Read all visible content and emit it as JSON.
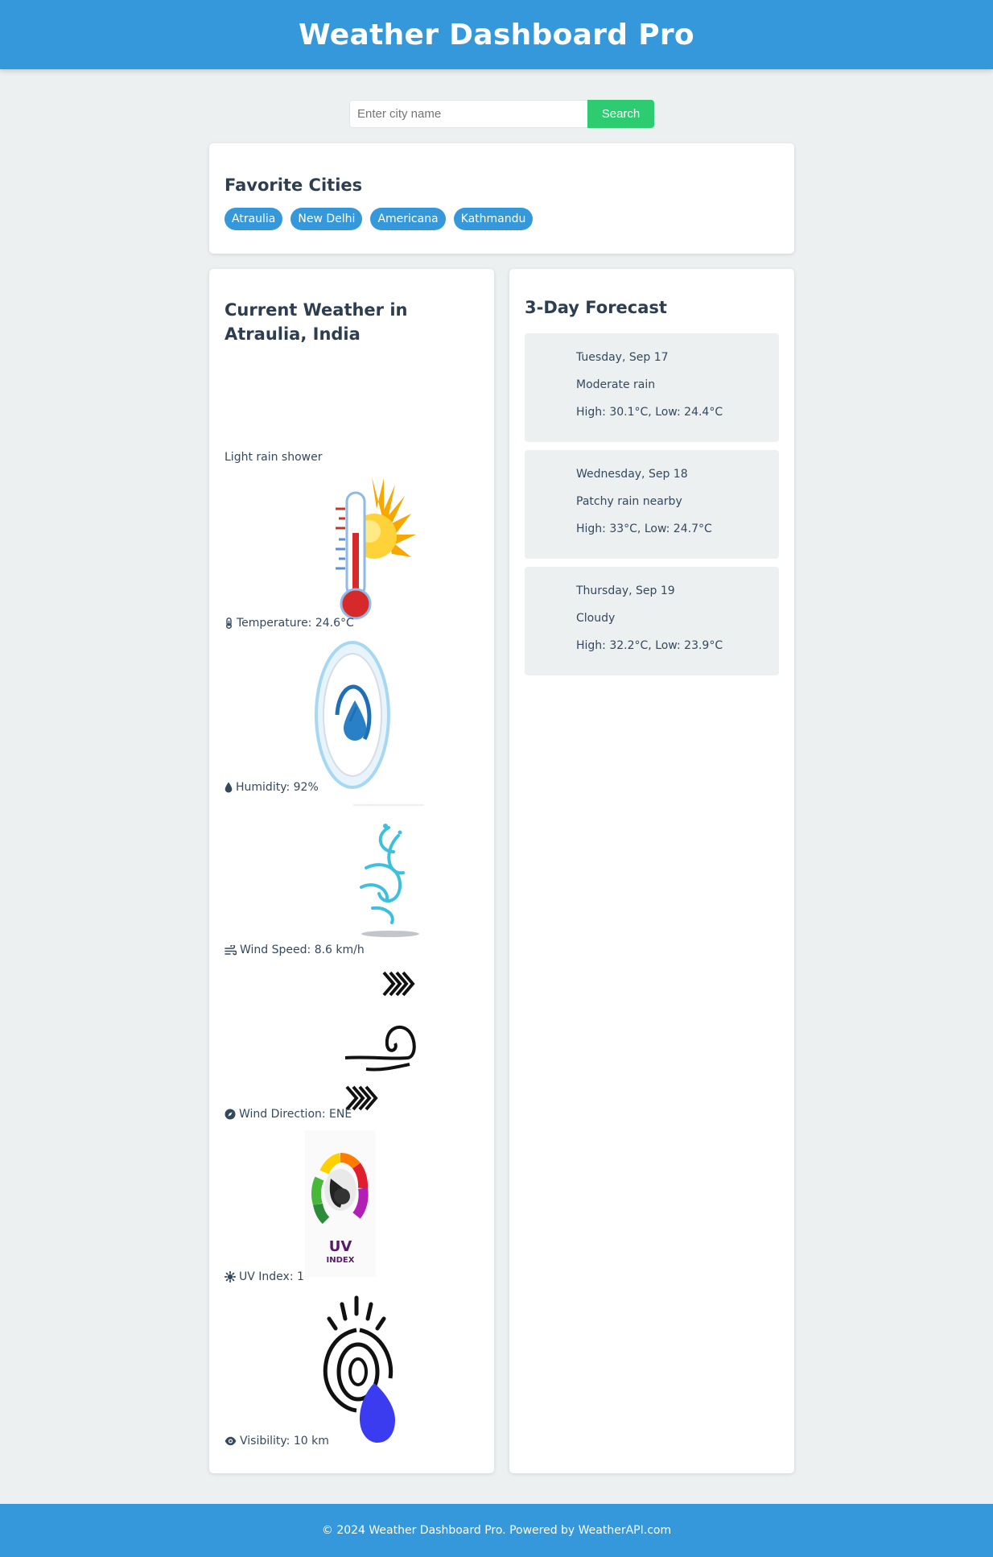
{
  "header": {
    "title": "Weather Dashboard Pro"
  },
  "search": {
    "placeholder": "Enter city name",
    "value": "",
    "button_label": "Search"
  },
  "favorites": {
    "title": "Favorite Cities",
    "cities": [
      "Atraulia",
      "New Delhi",
      "Americana",
      "Kathmandu"
    ]
  },
  "current": {
    "title": "Current Weather in Atraulia, India",
    "condition": "Light rain shower",
    "metrics": [
      {
        "icon": "thermometer-icon",
        "text": "Temperature: 24.6°C"
      },
      {
        "icon": "tint-icon",
        "text": "Humidity: 92%"
      },
      {
        "icon": "wind-icon",
        "text": "Wind Speed: 8.6 km/h"
      },
      {
        "icon": "compass-icon",
        "text": "Wind Direction: ENE"
      },
      {
        "icon": "sun-icon",
        "text": "UV Index: 1"
      },
      {
        "icon": "eye-icon",
        "text": "Visibility: 10 km"
      }
    ]
  },
  "forecast": {
    "title": "3-Day Forecast",
    "days": [
      {
        "date": "Tuesday, Sep 17",
        "condition": "Moderate rain",
        "temps": "High: 30.1°C, Low: 24.4°C"
      },
      {
        "date": "Wednesday, Sep 18",
        "condition": "Patchy rain nearby",
        "temps": "High: 33°C, Low: 24.7°C"
      },
      {
        "date": "Thursday, Sep 19",
        "condition": "Cloudy",
        "temps": "High: 32.2°C, Low: 23.9°C"
      }
    ]
  },
  "footer": {
    "text": "© 2024 Weather Dashboard Pro. Powered by WeatherAPI.com"
  },
  "colors": {
    "primary": "#3498db",
    "search_button": "#2ecc71",
    "background": "#ecf0f1",
    "text": "#2c3e50"
  }
}
